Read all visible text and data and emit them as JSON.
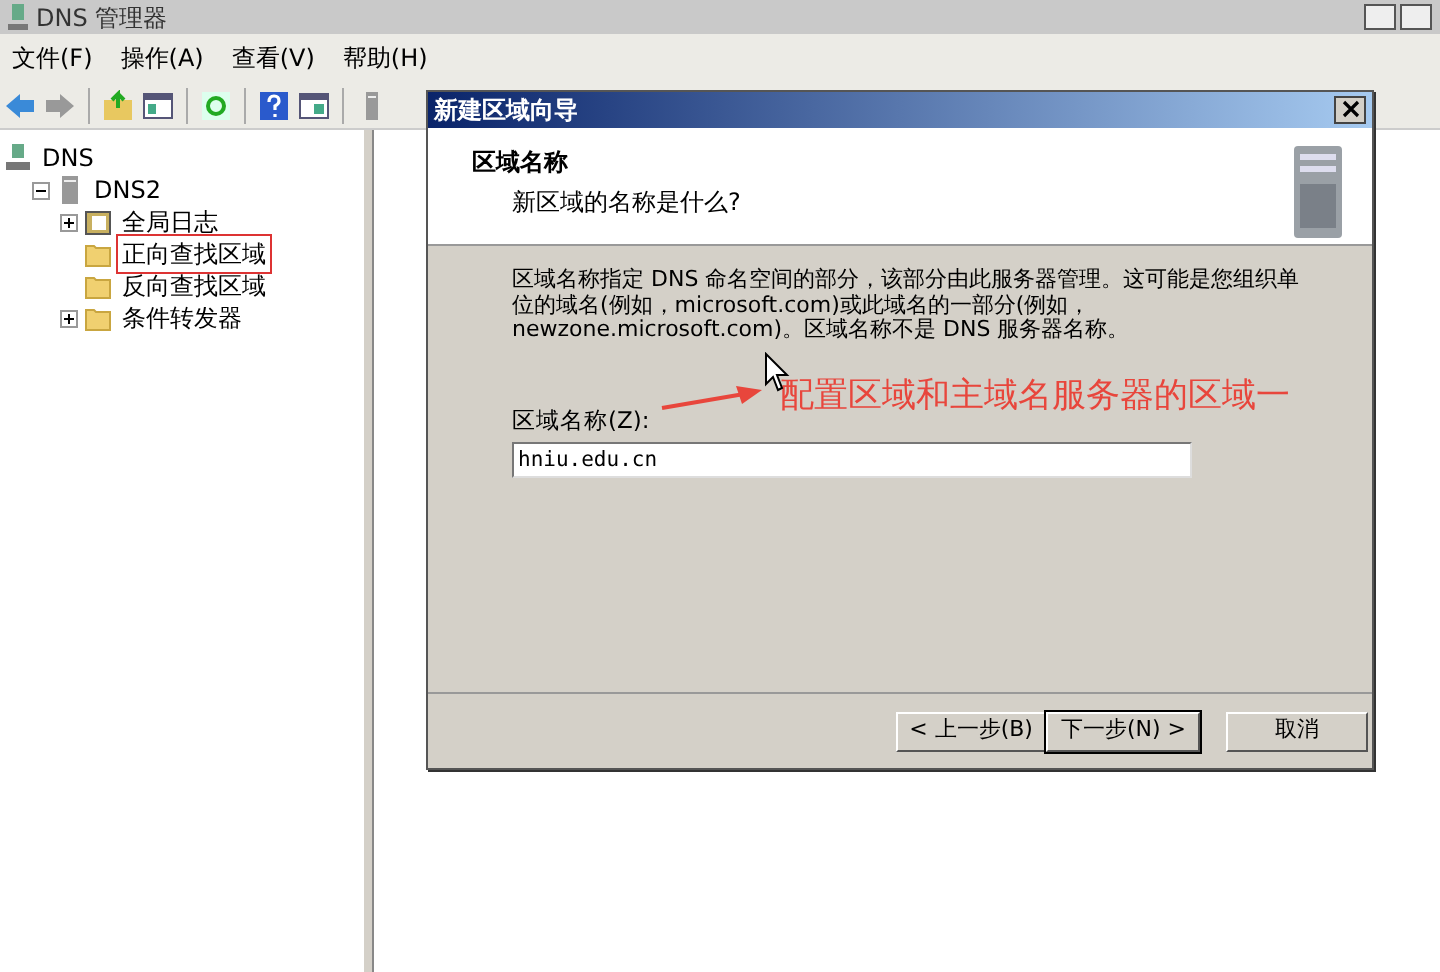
{
  "window": {
    "title": "DNS 管理器"
  },
  "menu": [
    "文件(F)",
    "操作(A)",
    "查看(V)",
    "帮助(H)"
  ],
  "toolbar": [
    {
      "kind": "back"
    },
    {
      "kind": "forward"
    },
    {
      "kind": "sep"
    },
    {
      "kind": "up"
    },
    {
      "kind": "tree"
    },
    {
      "kind": "sep"
    },
    {
      "kind": "refresh"
    },
    {
      "kind": "sep"
    },
    {
      "kind": "help"
    },
    {
      "kind": "panel"
    },
    {
      "kind": "sep"
    },
    {
      "kind": "server"
    }
  ],
  "tree": [
    {
      "label": "DNS",
      "kind": "root",
      "children": [
        {
          "label": "DNS2",
          "kind": "server",
          "expanded": true,
          "children": [
            {
              "label": "全局日志",
              "kind": "log",
              "expanded": false,
              "annotated": false
            },
            {
              "label": "正向查找区域",
              "kind": "folder",
              "annotated": true
            },
            {
              "label": "反向查找区域",
              "kind": "folder",
              "annotated": false
            },
            {
              "label": "条件转发器",
              "kind": "folder",
              "expanded": false,
              "annotated": false
            }
          ]
        }
      ]
    }
  ],
  "dialog": {
    "title": "新建区域向导",
    "heading": "区域名称",
    "subheading": "新区域的名称是什么?",
    "description": "区域名称指定 DNS 命名空间的部分，该部分由此服务器管理。这可能是您组织单位的域名(例如，microsoft.com)或此域名的一部分(例如，newzone.microsoft.com)。区域名称不是 DNS 服务器名称。",
    "field_label": "区域名称(Z):",
    "field_value": "hniu.edu.cn",
    "buttons": [
      {
        "label": "< 上一步(B)",
        "default": false
      },
      {
        "label": "下一步(N) >",
        "default": true
      },
      {
        "label": "取消",
        "default": false
      }
    ]
  },
  "annotation": {
    "text": "配置区域和主域名服务器的区域一"
  }
}
